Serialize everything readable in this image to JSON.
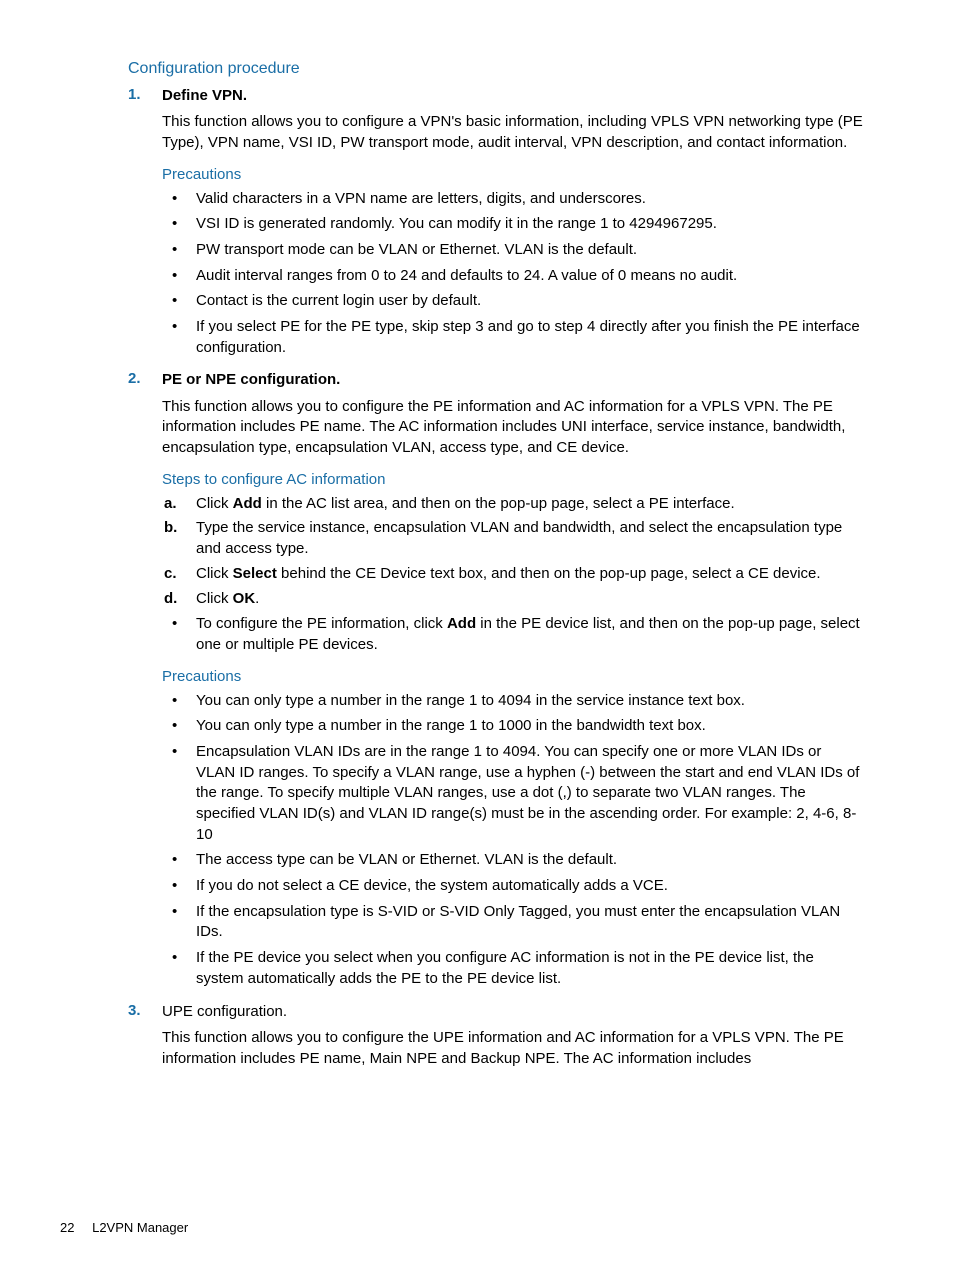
{
  "header": {
    "title": "Configuration procedure"
  },
  "steps": [
    {
      "num": "1.",
      "title": "Define VPN.",
      "title_bold": true,
      "body": "This function allows you to configure a VPN's basic information, including VPLS VPN networking type (PE Type), VPN name, VSI ID, PW transport mode, audit interval, VPN description, and contact information.",
      "sections": [
        {
          "heading": "Precautions",
          "type": "bullets",
          "items": [
            [
              {
                "t": "Valid characters in a VPN name are letters, digits, and underscores."
              }
            ],
            [
              {
                "t": "VSI ID is generated randomly. You can modify it in the range 1 to 4294967295."
              }
            ],
            [
              {
                "t": "PW transport mode can be VLAN or Ethernet. VLAN is the default."
              }
            ],
            [
              {
                "t": "Audit interval ranges from 0 to 24 and defaults to 24. A value of 0 means no audit."
              }
            ],
            [
              {
                "t": "Contact is the current login user by default."
              }
            ],
            [
              {
                "t": "If you select PE for the PE type, skip step 3 and go to step 4 directly after you finish the PE interface configuration."
              }
            ]
          ]
        }
      ]
    },
    {
      "num": "2.",
      "title": "PE or NPE configuration.",
      "title_bold": true,
      "body": "This function allows you to configure the PE information and AC information for a VPLS VPN. The PE information includes PE name. The AC information includes UNI interface, service instance, bandwidth, encapsulation type, encapsulation VLAN, access type, and CE device.",
      "sections": [
        {
          "heading": "Steps to configure AC information",
          "type": "letters",
          "items": [
            {
              "let": "a.",
              "parts": [
                {
                  "t": "Click "
                },
                {
                  "t": "Add",
                  "b": true
                },
                {
                  "t": " in the AC list area, and then on the pop-up page, select a PE interface."
                }
              ]
            },
            {
              "let": "b.",
              "parts": [
                {
                  "t": "Type the service instance, encapsulation VLAN and bandwidth, and select the encapsulation type and access type."
                }
              ]
            },
            {
              "let": "c.",
              "parts": [
                {
                  "t": "Click "
                },
                {
                  "t": "Select",
                  "b": true
                },
                {
                  "t": " behind the CE Device text box, and then on the pop-up page, select a CE device."
                }
              ]
            },
            {
              "let": "d.",
              "parts": [
                {
                  "t": "Click "
                },
                {
                  "t": "OK",
                  "b": true
                },
                {
                  "t": "."
                }
              ]
            }
          ],
          "trailing_bullets": [
            [
              {
                "t": "To configure the PE information, click "
              },
              {
                "t": "Add",
                "b": true
              },
              {
                "t": " in the PE device list, and then on the pop-up page, select one or multiple PE devices."
              }
            ]
          ]
        },
        {
          "heading": "Precautions",
          "type": "bullets",
          "items": [
            [
              {
                "t": "You can only type a number in the range 1 to 4094 in the service instance text box."
              }
            ],
            [
              {
                "t": "You can only type a number in the range 1 to 1000 in the bandwidth text box."
              }
            ],
            [
              {
                "t": "Encapsulation VLAN IDs are in the range 1 to 4094. You can specify one or more VLAN IDs or VLAN ID ranges. To specify a VLAN range, use a hyphen (-) between the start and end VLAN IDs of the range. To specify multiple VLAN ranges, use a dot (,) to separate two VLAN ranges. The specified VLAN ID(s) and VLAN ID range(s) must be in the ascending order. For example: 2, 4-6, 8-10"
              }
            ],
            [
              {
                "t": "The access type can be VLAN or Ethernet. VLAN is the default."
              }
            ],
            [
              {
                "t": "If you do not select a CE device, the system automatically adds a VCE."
              }
            ],
            [
              {
                "t": "If the encapsulation type is S-VID or S-VID Only Tagged, you must enter the encapsulation VLAN IDs."
              }
            ],
            [
              {
                "t": "If the PE device you select when you configure AC information is not in the PE device list, the system automatically adds the PE to the PE device list."
              }
            ]
          ]
        }
      ]
    },
    {
      "num": "3.",
      "title": "UPE configuration.",
      "title_bold": false,
      "body": "This function allows you to configure the UPE information and AC information for a VPLS VPN. The PE information includes PE name, Main NPE and Backup NPE. The AC information includes",
      "sections": []
    }
  ],
  "footer": {
    "page": "22",
    "title": "L2VPN Manager"
  }
}
